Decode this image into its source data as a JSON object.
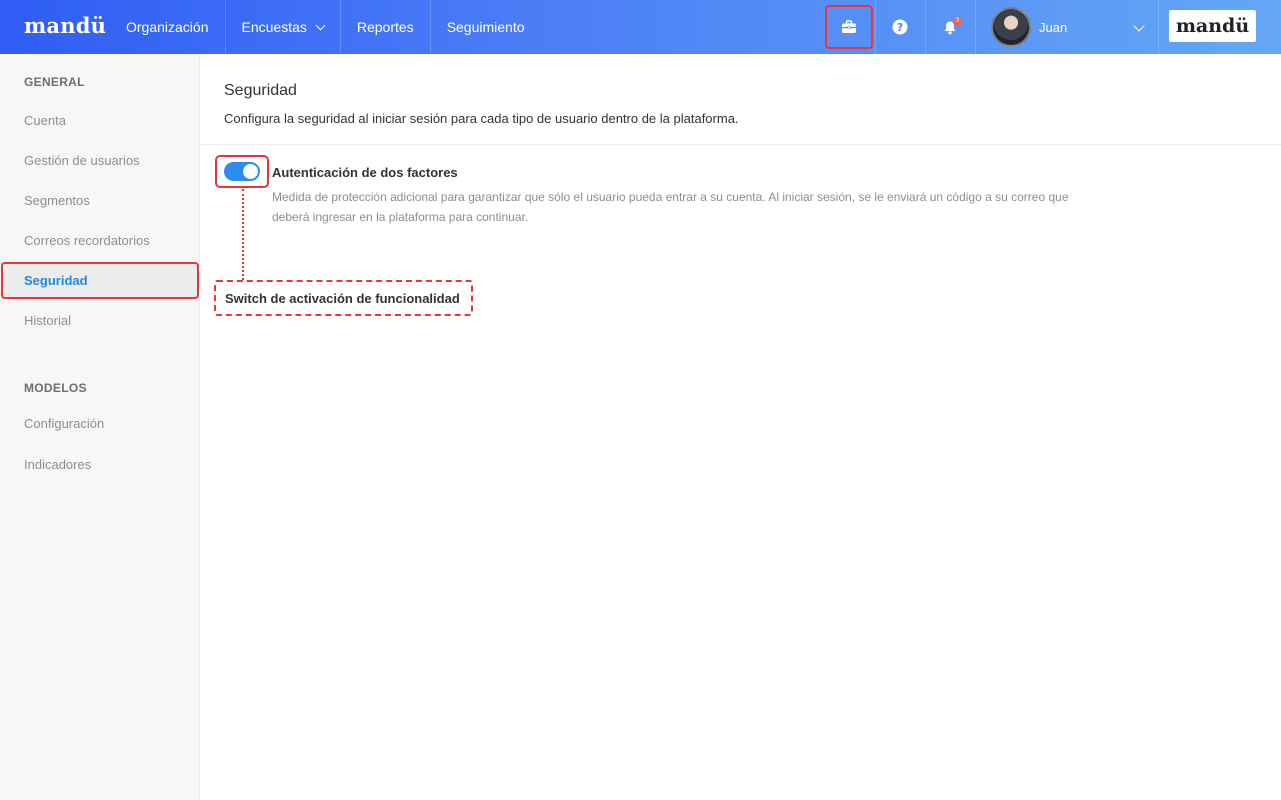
{
  "header": {
    "brand": "mandü",
    "nav": [
      {
        "label": "Organización"
      },
      {
        "label": "Encuestas"
      },
      {
        "label": "Reportes"
      },
      {
        "label": "Seguimiento"
      }
    ],
    "notifications_count": "3",
    "user_name": "Juan",
    "logo_text": "mandü"
  },
  "sidebar": {
    "general_heading": "GENERAL",
    "items": [
      {
        "label": "Cuenta"
      },
      {
        "label": "Gestión de usuarios"
      },
      {
        "label": "Segmentos"
      },
      {
        "label": "Correos recordatorios"
      },
      {
        "label": "Seguridad"
      },
      {
        "label": "Historial"
      }
    ],
    "models_heading": "MODELOS",
    "model_items": [
      {
        "label": "Configuración"
      },
      {
        "label": "Indicadores"
      }
    ]
  },
  "main": {
    "title": "Seguridad",
    "description": "Configura la seguridad al iniciar sesión para cada tipo de usuario dentro de la plataforma.",
    "feature": {
      "title": "Autenticación de dos factores",
      "description": "Medida de protección adicional para garantizar que sólo el usuario pueda entrar a su cuenta. Al iniciar sesión, se le enviará un código a su correo que deberá ingresar en la plataforma para continuar.",
      "enabled": true
    },
    "annotation": "Switch de activación de funcionalidad"
  },
  "colors": {
    "accent": "#2d8cf0",
    "active_link": "#1f87e8",
    "highlight": "#e8353c",
    "header_start": "#2f5df5",
    "header_end": "#64a7f5"
  },
  "icons": [
    "briefcase-icon",
    "help-icon",
    "bell-icon",
    "chevron-down-icon"
  ]
}
